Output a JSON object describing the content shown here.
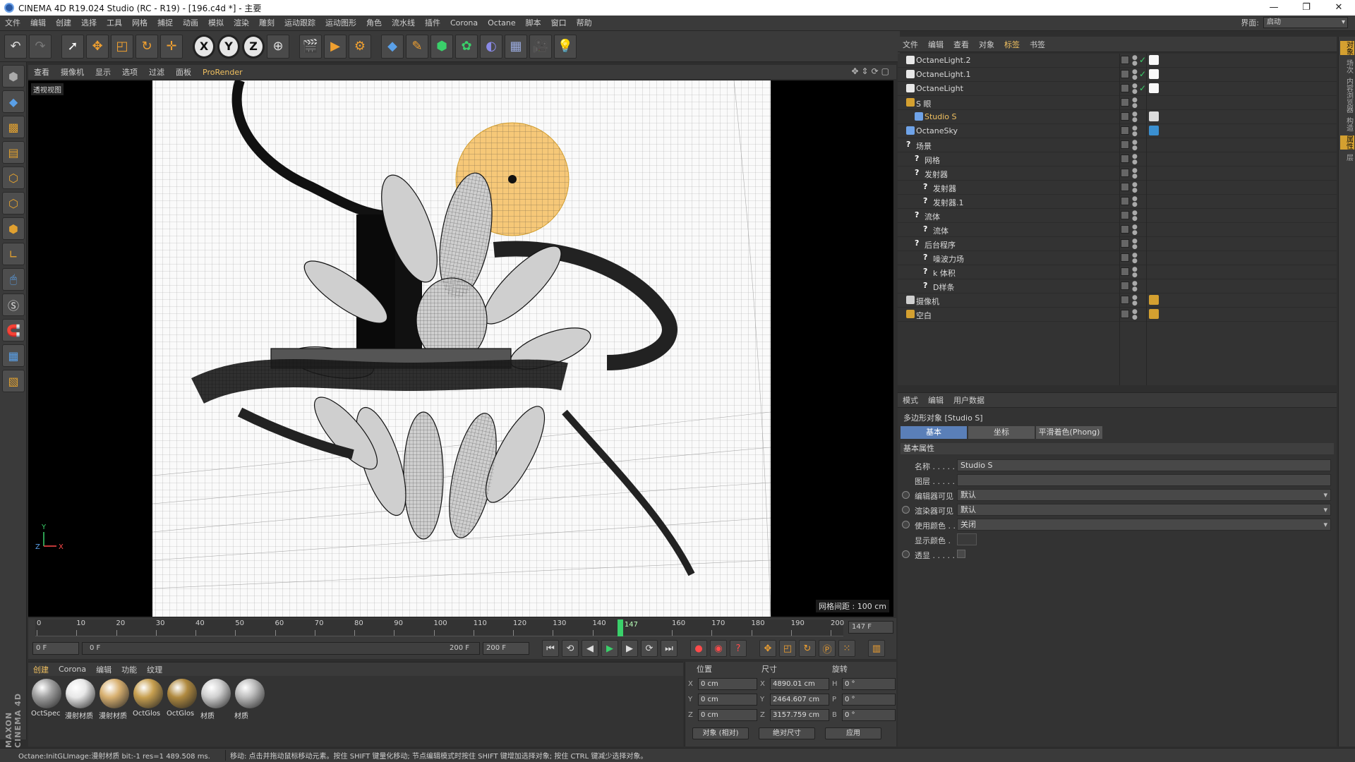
{
  "title": "CINEMA 4D R19.024 Studio (RC - R19) - [196.c4d *] - 主要",
  "window_buttons": [
    "—",
    "❐",
    "✕"
  ],
  "menus": [
    "文件",
    "编辑",
    "创建",
    "选择",
    "工具",
    "网格",
    "捕捉",
    "动画",
    "模拟",
    "渲染",
    "雕刻",
    "运动跟踪",
    "运动图形",
    "角色",
    "流水线",
    "插件",
    "Corona",
    "Octane",
    "脚本",
    "窗口",
    "帮助"
  ],
  "interface": {
    "label": "界面:",
    "value": "启动"
  },
  "viewport": {
    "menus": [
      "查看",
      "摄像机",
      "显示",
      "选项",
      "过滤",
      "面板",
      "ProRender"
    ],
    "label": "透视视图",
    "grid_info": "网格间距 : 100 cm",
    "axis_x": "X",
    "axis_y": "Y",
    "axis_z": "Z"
  },
  "timeline": {
    "ticks": [
      "0",
      "10",
      "20",
      "30",
      "40",
      "50",
      "60",
      "70",
      "80",
      "90",
      "100",
      "110",
      "120",
      "130",
      "140",
      "147",
      "160",
      "170",
      "180",
      "190",
      "200"
    ],
    "current_frame_label": "147",
    "current_frame": 147,
    "max_frame": 200,
    "end_field": "147 F"
  },
  "playback": {
    "start": "0 F",
    "slider_left": "0 F",
    "slider_right": "200 F",
    "end": "200 F"
  },
  "materials": {
    "menus": [
      "创建",
      "Corona",
      "编辑",
      "功能",
      "纹理"
    ],
    "items": [
      {
        "label": "OctSpec",
        "color": "#a0a0a0"
      },
      {
        "label": "漫射材质",
        "color": "#e8e8e8"
      },
      {
        "label": "漫射材质",
        "color": "#d8b070"
      },
      {
        "label": "OctGlos",
        "color": "#c8a050"
      },
      {
        "label": "OctGlos",
        "color": "#b08a40"
      },
      {
        "label": "材质",
        "color": "#d0d0d0"
      },
      {
        "label": "材质",
        "color": "#bcbcbc"
      }
    ]
  },
  "coords": {
    "headers": [
      "位置",
      "尺寸",
      "旋转"
    ],
    "rows": [
      {
        "a": "X",
        "pos": "0 cm",
        "b": "X",
        "size": "4890.01 cm",
        "c": "H",
        "rot": "0 °"
      },
      {
        "a": "Y",
        "pos": "0 cm",
        "b": "Y",
        "size": "2464.607 cm",
        "c": "P",
        "rot": "0 °"
      },
      {
        "a": "Z",
        "pos": "0 cm",
        "b": "Z",
        "size": "3157.759 cm",
        "c": "B",
        "rot": "0 °"
      }
    ],
    "mode": "对象 (相对)",
    "size_mode": "绝对尺寸",
    "apply": "应用"
  },
  "status": {
    "left": "Octane:InitGLImage:漫射材质  bit:-1 res=1  489.508 ms.",
    "right": "移动: 点击并拖动鼠标移动元素。按住 SHIFT 键量化移动; 节点编辑模式时按住 SHIFT 键增加选择对象; 按住 CTRL 键减少选择对象。"
  },
  "object_manager": {
    "menus": [
      "文件",
      "编辑",
      "查看",
      "对象",
      "标签",
      "书签"
    ],
    "objects": [
      {
        "name": "OctaneLight.2",
        "indent": 0,
        "q": "",
        "icon_color": "#e8e8e8",
        "tag_color": "#f8f8f8",
        "check": "✓"
      },
      {
        "name": "OctaneLight.1",
        "indent": 0,
        "q": "",
        "icon_color": "#e8e8e8",
        "tag_color": "#f8f8f8",
        "check": "✓"
      },
      {
        "name": "OctaneLight",
        "indent": 0,
        "q": "",
        "icon_color": "#e8e8e8",
        "tag_color": "#f8f8f8",
        "check": "✓"
      },
      {
        "name": "S 眼",
        "indent": 0,
        "q": "",
        "icon_color": "#d4a030",
        "tag_color": "",
        "check": ""
      },
      {
        "name": "Studio S",
        "indent": 1,
        "q": "",
        "icon_color": "#6fa3e8",
        "tag_color": "#dddddd",
        "check": "",
        "selected": true
      },
      {
        "name": "OctaneSky",
        "indent": 0,
        "q": "",
        "icon_color": "#6fa3e8",
        "tag_color": "#3a8fd0",
        "check": ""
      },
      {
        "name": "场景",
        "indent": 0,
        "q": "?",
        "icon_color": "",
        "tag_color": "",
        "check": ""
      },
      {
        "name": "网格",
        "indent": 1,
        "q": "?",
        "icon_color": "",
        "tag_color": "",
        "check": ""
      },
      {
        "name": "发射器",
        "indent": 1,
        "q": "?",
        "icon_color": "",
        "tag_color": "",
        "check": ""
      },
      {
        "name": "发射器",
        "indent": 2,
        "q": "?",
        "icon_color": "",
        "tag_color": "",
        "check": ""
      },
      {
        "name": "发射器.1",
        "indent": 2,
        "q": "?",
        "icon_color": "",
        "tag_color": "",
        "check": ""
      },
      {
        "name": "流体",
        "indent": 1,
        "q": "?",
        "icon_color": "",
        "tag_color": "",
        "check": ""
      },
      {
        "name": "流体",
        "indent": 2,
        "q": "?",
        "icon_color": "",
        "tag_color": "",
        "check": ""
      },
      {
        "name": "后台程序",
        "indent": 1,
        "q": "?",
        "icon_color": "",
        "tag_color": "",
        "check": ""
      },
      {
        "name": "噪波力场",
        "indent": 2,
        "q": "?",
        "icon_color": "",
        "tag_color": "",
        "check": ""
      },
      {
        "name": "k 体积",
        "indent": 2,
        "q": "?",
        "icon_color": "",
        "tag_color": "",
        "check": ""
      },
      {
        "name": "D样条",
        "indent": 2,
        "q": "?",
        "icon_color": "",
        "tag_color": "",
        "check": ""
      },
      {
        "name": "摄像机",
        "indent": 0,
        "q": "",
        "icon_color": "#cfcfcf",
        "tag_color": "#d4a030",
        "check": ""
      },
      {
        "name": "空白",
        "indent": 0,
        "q": "",
        "icon_color": "#d4a030",
        "tag_color": "#d4a030",
        "check": ""
      }
    ]
  },
  "attributes": {
    "menus": [
      "模式",
      "编辑",
      "用户数据"
    ],
    "title": "多边形对象 [Studio S]",
    "tabs": [
      "基本",
      "坐标",
      "平滑着色(Phong)"
    ],
    "section": "基本属性",
    "rows": [
      {
        "label": "名称 . . . . . .",
        "value": "Studio S",
        "kind": "text",
        "radio": false
      },
      {
        "label": "图层 . . . . . .",
        "value": "",
        "kind": "text",
        "radio": false
      },
      {
        "label": "编辑器可见",
        "value": "默认",
        "kind": "dd",
        "radio": true
      },
      {
        "label": "渲染器可见",
        "value": "默认",
        "kind": "dd",
        "radio": true
      },
      {
        "label": "使用颜色 . .",
        "value": "关闭",
        "kind": "dd",
        "radio": true
      },
      {
        "label": "显示颜色 .",
        "value": "",
        "kind": "swatch",
        "radio": false
      },
      {
        "label": "透显 . . . . . .",
        "value": "",
        "kind": "box",
        "radio": true
      }
    ]
  },
  "right_strip": [
    "对象",
    "场次",
    "内容浏览器",
    "构造",
    "属性",
    "层"
  ]
}
